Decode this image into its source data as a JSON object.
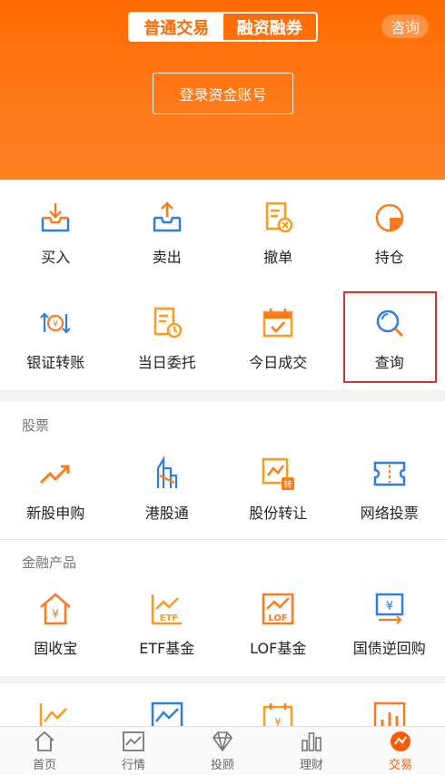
{
  "header": {
    "seg_normal": "普通交易",
    "seg_margin": "融资融券",
    "consult": "咨询",
    "login": "登录资金账号"
  },
  "trade_grid": [
    {
      "label": "买入",
      "icon": "inbox-download-icon"
    },
    {
      "label": "卖出",
      "icon": "inbox-upload-icon"
    },
    {
      "label": "撤单",
      "icon": "cancel-order-icon"
    },
    {
      "label": "持仓",
      "icon": "pie-chart-icon"
    },
    {
      "label": "银证转账",
      "icon": "transfer-icon"
    },
    {
      "label": "当日委托",
      "icon": "clock-document-icon"
    },
    {
      "label": "今日成交",
      "icon": "calendar-check-icon"
    },
    {
      "label": "查询",
      "icon": "search-icon"
    }
  ],
  "stocks": {
    "title": "股票",
    "items": [
      {
        "label": "新股申购",
        "icon": "trend-up-icon"
      },
      {
        "label": "港股通",
        "icon": "building-icon"
      },
      {
        "label": "股份转让",
        "icon": "chart-transfer-icon"
      },
      {
        "label": "网络投票",
        "icon": "ticket-icon"
      }
    ]
  },
  "products": {
    "title": "金融产品",
    "items": [
      {
        "label": "固收宝",
        "icon": "house-yen-icon"
      },
      {
        "label": "ETF基金",
        "icon": "etf-chart-icon",
        "badge": "ETF"
      },
      {
        "label": "LOF基金",
        "icon": "lof-chart-icon",
        "badge": "LOF"
      },
      {
        "label": "国债逆回购",
        "icon": "yen-repo-icon"
      }
    ]
  },
  "tabbar": [
    {
      "label": "首页",
      "icon": "home-icon"
    },
    {
      "label": "行情",
      "icon": "market-chart-icon"
    },
    {
      "label": "投顾",
      "icon": "diamond-icon"
    },
    {
      "label": "理财",
      "icon": "bars-icon"
    },
    {
      "label": "交易",
      "icon": "trade-icon",
      "active": true
    }
  ],
  "colors": {
    "orange": "#ff6a00",
    "blue": "#2f7fe0",
    "highlight": "#d9332e"
  }
}
